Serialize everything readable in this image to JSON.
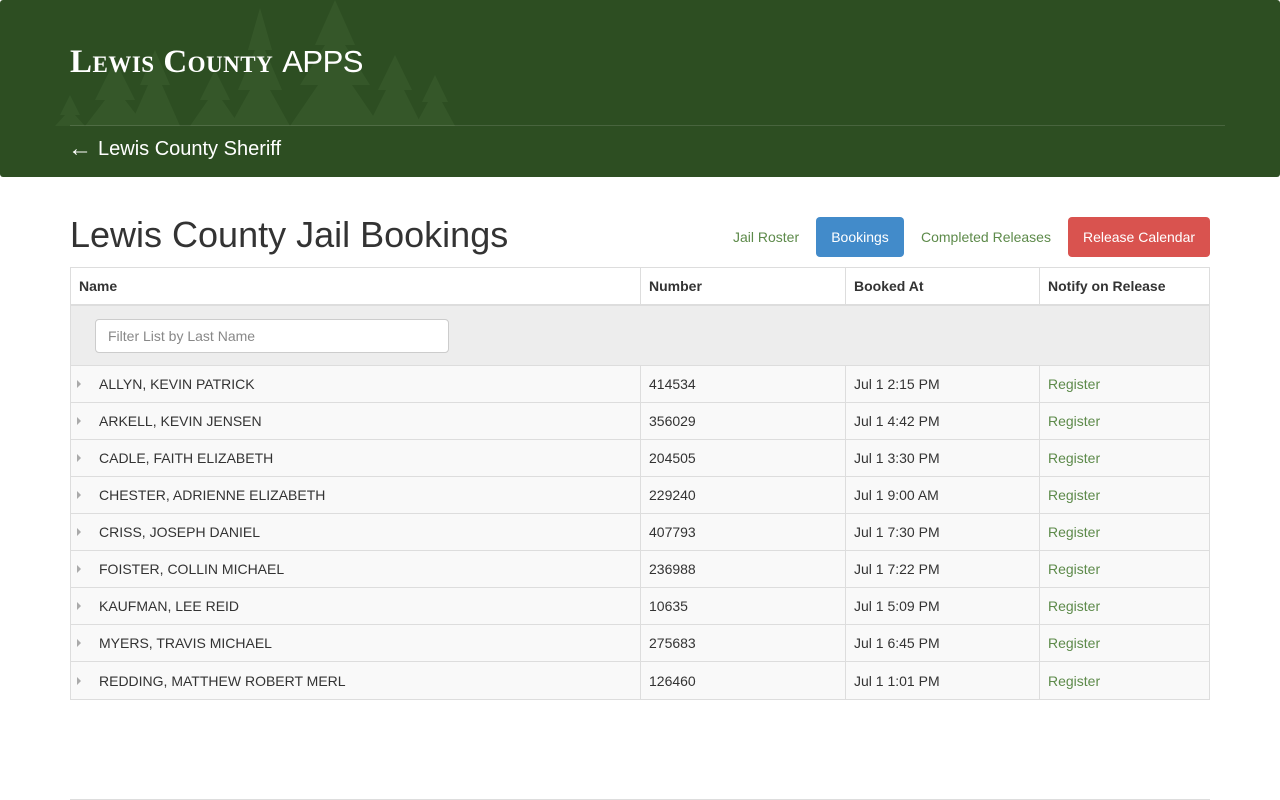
{
  "header": {
    "brand_bold": "Lewis County",
    "brand_light": "APPS",
    "back_link": "Lewis County Sheriff",
    "back_arrow": "←",
    "color": "#2d4e22"
  },
  "page": {
    "title": "Lewis County Jail Bookings"
  },
  "nav": {
    "jail_roster": "Jail Roster",
    "bookings": "Bookings",
    "completed_releases": "Completed Releases",
    "release_calendar": "Release Calendar",
    "active": "Bookings",
    "active_color": "#428bca",
    "calendar_color": "#d9534f"
  },
  "table": {
    "columns": [
      "Name",
      "Number",
      "Booked At",
      "Notify on Release"
    ],
    "filter_placeholder": "Filter List by Last Name",
    "rows": [
      {
        "name": "ALLYN, KEVIN PATRICK",
        "number": "414534",
        "booked_at": "Jul 1 2:15 PM",
        "notify": "Register"
      },
      {
        "name": "ARKELL, KEVIN JENSEN",
        "number": "356029",
        "booked_at": "Jul 1 4:42 PM",
        "notify": "Register"
      },
      {
        "name": "CADLE, FAITH ELIZABETH",
        "number": "204505",
        "booked_at": "Jul 1 3:30 PM",
        "notify": "Register"
      },
      {
        "name": "CHESTER, ADRIENNE ELIZABETH",
        "number": "229240",
        "booked_at": "Jul 1 9:00 AM",
        "notify": "Register"
      },
      {
        "name": "CRISS, JOSEPH DANIEL",
        "number": "407793",
        "booked_at": "Jul 1 7:30 PM",
        "notify": "Register"
      },
      {
        "name": "FOISTER, COLLIN MICHAEL",
        "number": "236988",
        "booked_at": "Jul 1 7:22 PM",
        "notify": "Register"
      },
      {
        "name": "KAUFMAN, LEE REID",
        "number": "10635",
        "booked_at": "Jul 1 5:09 PM",
        "notify": "Register"
      },
      {
        "name": "MYERS, TRAVIS MICHAEL",
        "number": "275683",
        "booked_at": "Jul 1 6:45 PM",
        "notify": "Register"
      },
      {
        "name": "REDDING, MATTHEW ROBERT MERL",
        "number": "126460",
        "booked_at": "Jul 1 1:01 PM",
        "notify": "Register"
      }
    ]
  }
}
